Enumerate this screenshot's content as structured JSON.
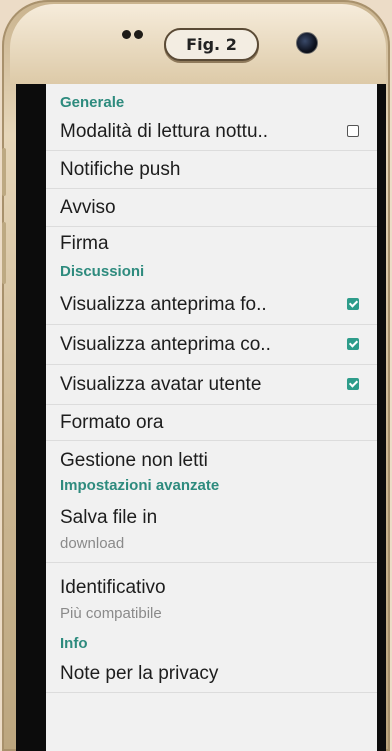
{
  "figure_label": "Fig. 2",
  "settings": {
    "sections": [
      {
        "title": "Generale",
        "items": [
          {
            "label": "Modalità di lettura nottu..",
            "checkbox": "off"
          },
          {
            "label": "Notifiche push"
          },
          {
            "label": "Avviso"
          },
          {
            "label": "Firma"
          }
        ]
      },
      {
        "title": "Discussioni",
        "items": [
          {
            "label": "Visualizza anteprima fo..",
            "checkbox": "on"
          },
          {
            "label": "Visualizza anteprima co..",
            "checkbox": "on"
          },
          {
            "label": "Visualizza avatar utente",
            "checkbox": "on"
          },
          {
            "label": "Formato ora"
          },
          {
            "label": "Gestione non letti"
          }
        ]
      },
      {
        "title": "Impostazioni avanzate",
        "items": [
          {
            "label": "Salva file in",
            "value": "download"
          },
          {
            "label": "Identificativo",
            "value": "Più compatibile"
          }
        ]
      },
      {
        "title": "Info",
        "items": [
          {
            "label": "Note per la privacy"
          }
        ]
      }
    ]
  },
  "colors": {
    "section_title": "#2e8b7e",
    "checkbox_on": "#2e9c8a"
  }
}
